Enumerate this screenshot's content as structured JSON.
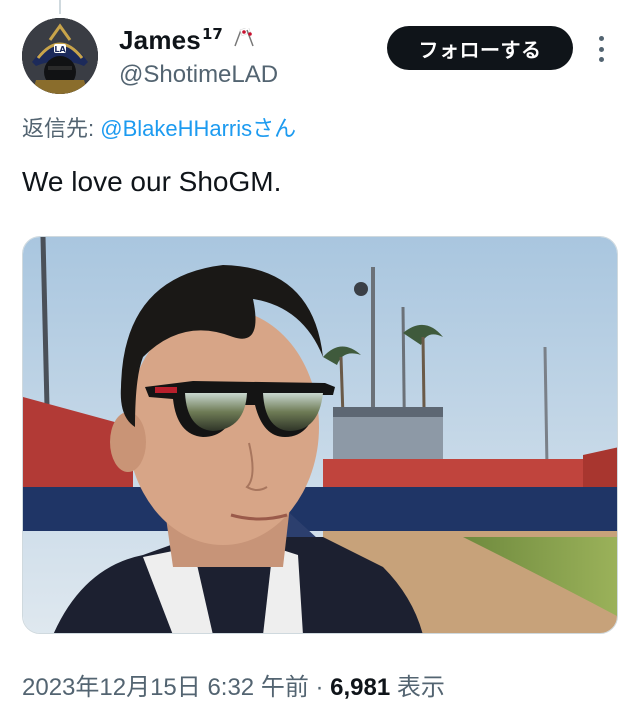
{
  "author": {
    "display_name": "James",
    "name_superscript": "17",
    "name_emoji": "🇯🇵",
    "handle": "@ShotimeLAD",
    "avatar_icon": "samurai-helmet-avatar"
  },
  "actions": {
    "follow_label": "フォローする",
    "more_icon": "more-vertical-icon"
  },
  "reply": {
    "prefix": "返信先: ",
    "mention": "@BlakeHHarris",
    "suffix": "さん"
  },
  "tweet": {
    "text": "We love our ShoGM."
  },
  "media": {
    "alt": ""
  },
  "meta": {
    "timestamp": "2023年12月15日 6:32 午前",
    "separator": " · ",
    "views_count": "6,981",
    "views_label": " 表示"
  },
  "colors": {
    "text_primary": "#0f1419",
    "text_secondary": "#536471",
    "link": "#1d9bf0",
    "button_bg": "#0f1419"
  }
}
